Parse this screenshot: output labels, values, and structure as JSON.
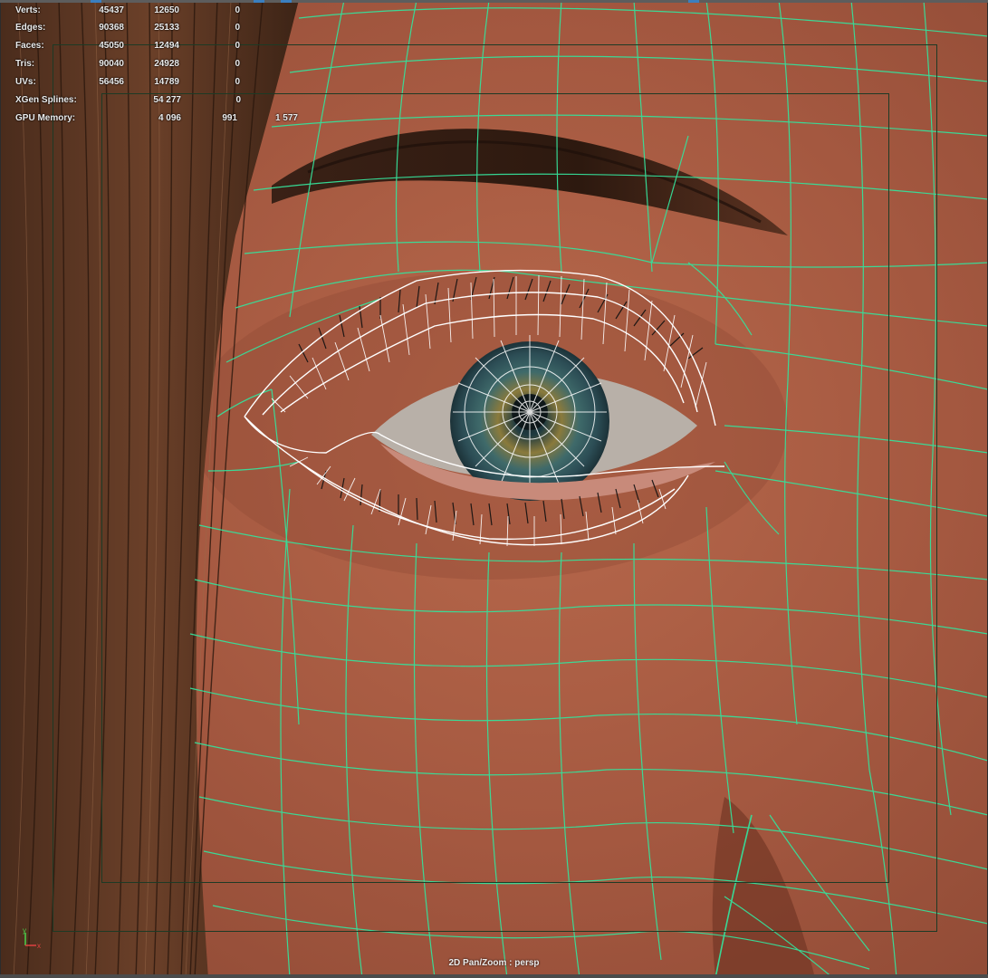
{
  "viewport": {
    "camera_label": "2D Pan/Zoom : persp",
    "wire_color": "#36e09a",
    "eye_wire_color": "#ffffff",
    "skin_color": "#a85a40"
  },
  "hud": {
    "rows": [
      {
        "label": "Verts:",
        "v1": "45437",
        "v2": "12650",
        "v3": "0"
      },
      {
        "label": "Edges:",
        "v1": "90368",
        "v2": "25133",
        "v3": "0"
      },
      {
        "label": "Faces:",
        "v1": "45050",
        "v2": "12494",
        "v3": "0"
      },
      {
        "label": "Tris:",
        "v1": "90040",
        "v2": "24928",
        "v3": "0"
      },
      {
        "label": "UVs:",
        "v1": "56456",
        "v2": "14789",
        "v3": "0"
      },
      {
        "label": "XGen Splines:",
        "v1": "54 277",
        "v2": "0",
        "v3": ""
      },
      {
        "label": "GPU Memory:",
        "v1": "4 096",
        "v2": "991",
        "v3": "1 577"
      }
    ]
  },
  "axis": {
    "x_label": "x",
    "y_label": "y"
  }
}
